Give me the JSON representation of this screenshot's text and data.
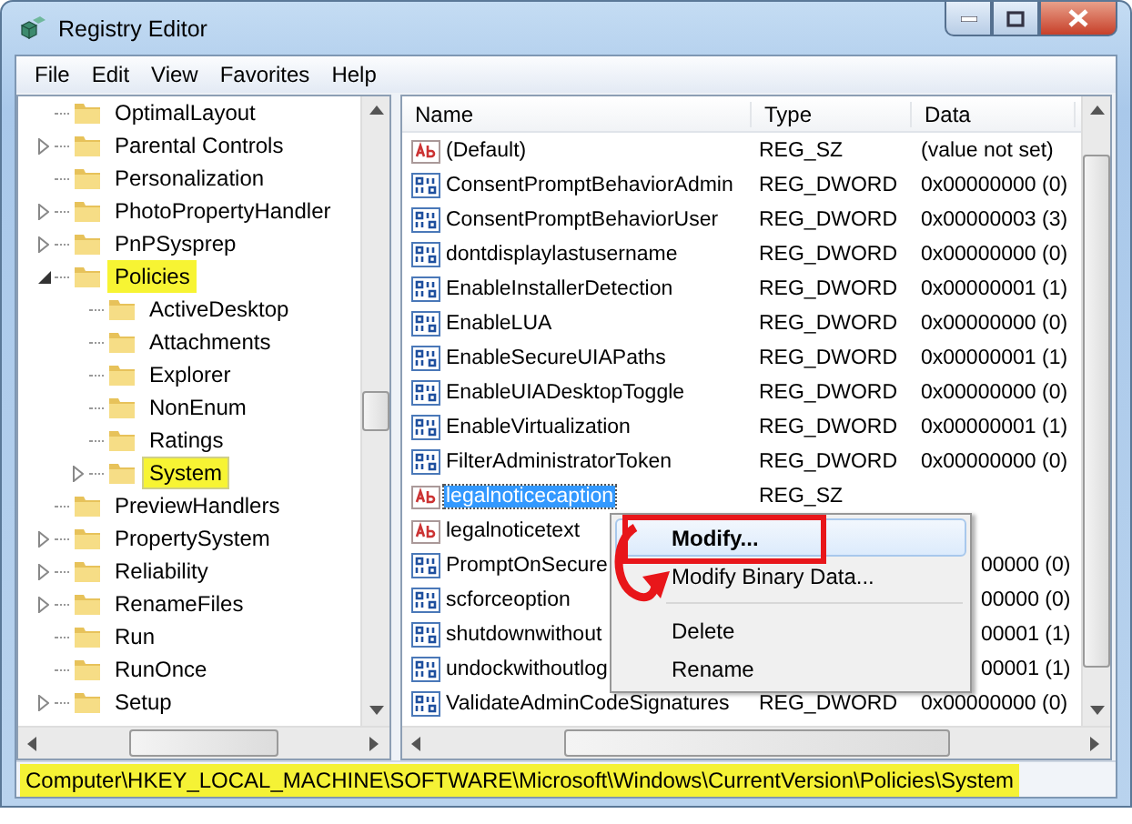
{
  "window": {
    "title": "Registry Editor"
  },
  "menu_bar": [
    "File",
    "Edit",
    "View",
    "Favorites",
    "Help"
  ],
  "tree": [
    {
      "label": "OptimalLayout",
      "expandable": false,
      "highlighted": false,
      "selected": false
    },
    {
      "label": "Parental Controls",
      "expandable": true,
      "expanded": false,
      "highlighted": false,
      "selected": false
    },
    {
      "label": "Personalization",
      "expandable": false,
      "highlighted": false,
      "selected": false
    },
    {
      "label": "PhotoPropertyHandler",
      "expandable": true,
      "expanded": false,
      "highlighted": false,
      "selected": false
    },
    {
      "label": "PnPSysprep",
      "expandable": true,
      "expanded": false,
      "highlighted": false,
      "selected": false
    },
    {
      "label": "Policies",
      "expandable": true,
      "expanded": true,
      "highlighted": true,
      "selected": false,
      "children": [
        {
          "label": "ActiveDesktop",
          "expandable": false,
          "highlighted": false,
          "selected": false
        },
        {
          "label": "Attachments",
          "expandable": false,
          "highlighted": false,
          "selected": false
        },
        {
          "label": "Explorer",
          "expandable": false,
          "highlighted": false,
          "selected": false
        },
        {
          "label": "NonEnum",
          "expandable": false,
          "highlighted": false,
          "selected": false
        },
        {
          "label": "Ratings",
          "expandable": false,
          "highlighted": false,
          "selected": false
        },
        {
          "label": "System",
          "expandable": true,
          "expanded": false,
          "highlighted": true,
          "selected": true
        }
      ]
    },
    {
      "label": "PreviewHandlers",
      "expandable": false,
      "highlighted": false,
      "selected": false
    },
    {
      "label": "PropertySystem",
      "expandable": true,
      "expanded": false,
      "highlighted": false,
      "selected": false
    },
    {
      "label": "Reliability",
      "expandable": true,
      "expanded": false,
      "highlighted": false,
      "selected": false
    },
    {
      "label": "RenameFiles",
      "expandable": true,
      "expanded": false,
      "highlighted": false,
      "selected": false
    },
    {
      "label": "Run",
      "expandable": false,
      "highlighted": false,
      "selected": false
    },
    {
      "label": "RunOnce",
      "expandable": false,
      "highlighted": false,
      "selected": false
    },
    {
      "label": "Setup",
      "expandable": true,
      "expanded": false,
      "highlighted": false,
      "selected": false
    }
  ],
  "values": {
    "columns": [
      "Name",
      "Type",
      "Data"
    ],
    "rows": [
      {
        "kind": "string",
        "name": "(Default)",
        "type": "REG_SZ",
        "data": "(value not set)",
        "selected": false
      },
      {
        "kind": "dword",
        "name": "ConsentPromptBehaviorAdmin",
        "type": "REG_DWORD",
        "data": "0x00000000 (0)",
        "selected": false
      },
      {
        "kind": "dword",
        "name": "ConsentPromptBehaviorUser",
        "type": "REG_DWORD",
        "data": "0x00000003 (3)",
        "selected": false
      },
      {
        "kind": "dword",
        "name": "dontdisplaylastusername",
        "type": "REG_DWORD",
        "data": "0x00000000 (0)",
        "selected": false
      },
      {
        "kind": "dword",
        "name": "EnableInstallerDetection",
        "type": "REG_DWORD",
        "data": "0x00000001 (1)",
        "selected": false
      },
      {
        "kind": "dword",
        "name": "EnableLUA",
        "type": "REG_DWORD",
        "data": "0x00000000 (0)",
        "selected": false
      },
      {
        "kind": "dword",
        "name": "EnableSecureUIAPaths",
        "type": "REG_DWORD",
        "data": "0x00000001 (1)",
        "selected": false
      },
      {
        "kind": "dword",
        "name": "EnableUIADesktopToggle",
        "type": "REG_DWORD",
        "data": "0x00000000 (0)",
        "selected": false
      },
      {
        "kind": "dword",
        "name": "EnableVirtualization",
        "type": "REG_DWORD",
        "data": "0x00000001 (1)",
        "selected": false
      },
      {
        "kind": "dword",
        "name": "FilterAdministratorToken",
        "type": "REG_DWORD",
        "data": "0x00000000 (0)",
        "selected": false
      },
      {
        "kind": "string",
        "name": "legalnoticecaption",
        "type": "REG_SZ",
        "selected": true
      },
      {
        "kind": "string",
        "name": "legalnoticetext",
        "selected": false
      },
      {
        "kind": "dword",
        "name": "PromptOnSecure",
        "data": "00000 (0)",
        "selected": false
      },
      {
        "kind": "dword",
        "name": "scforceoption",
        "data": "00000 (0)",
        "selected": false
      },
      {
        "kind": "dword",
        "name": "shutdownwithout",
        "data": "00001 (1)",
        "selected": false
      },
      {
        "kind": "dword",
        "name": "undockwithoutlog",
        "data": "00001 (1)",
        "selected": false
      },
      {
        "kind": "dword",
        "name": "ValidateAdminCodeSignatures",
        "type": "REG_DWORD",
        "data": "0x00000000 (0)",
        "selected": false
      }
    ]
  },
  "context_menu": [
    {
      "kind": "item",
      "label": "Modify...",
      "bold": true,
      "selected": true
    },
    {
      "kind": "item",
      "label": "Modify Binary Data...",
      "bold": false,
      "selected": false
    },
    {
      "kind": "separator"
    },
    {
      "kind": "item",
      "label": "Delete",
      "bold": false,
      "selected": false
    },
    {
      "kind": "item",
      "label": "Rename",
      "bold": false,
      "selected": false
    }
  ],
  "status_bar": {
    "path": "Computer\\HKEY_LOCAL_MACHINE\\SOFTWARE\\Microsoft\\Windows\\CurrentVersion\\Policies\\System",
    "highlighted": true
  }
}
